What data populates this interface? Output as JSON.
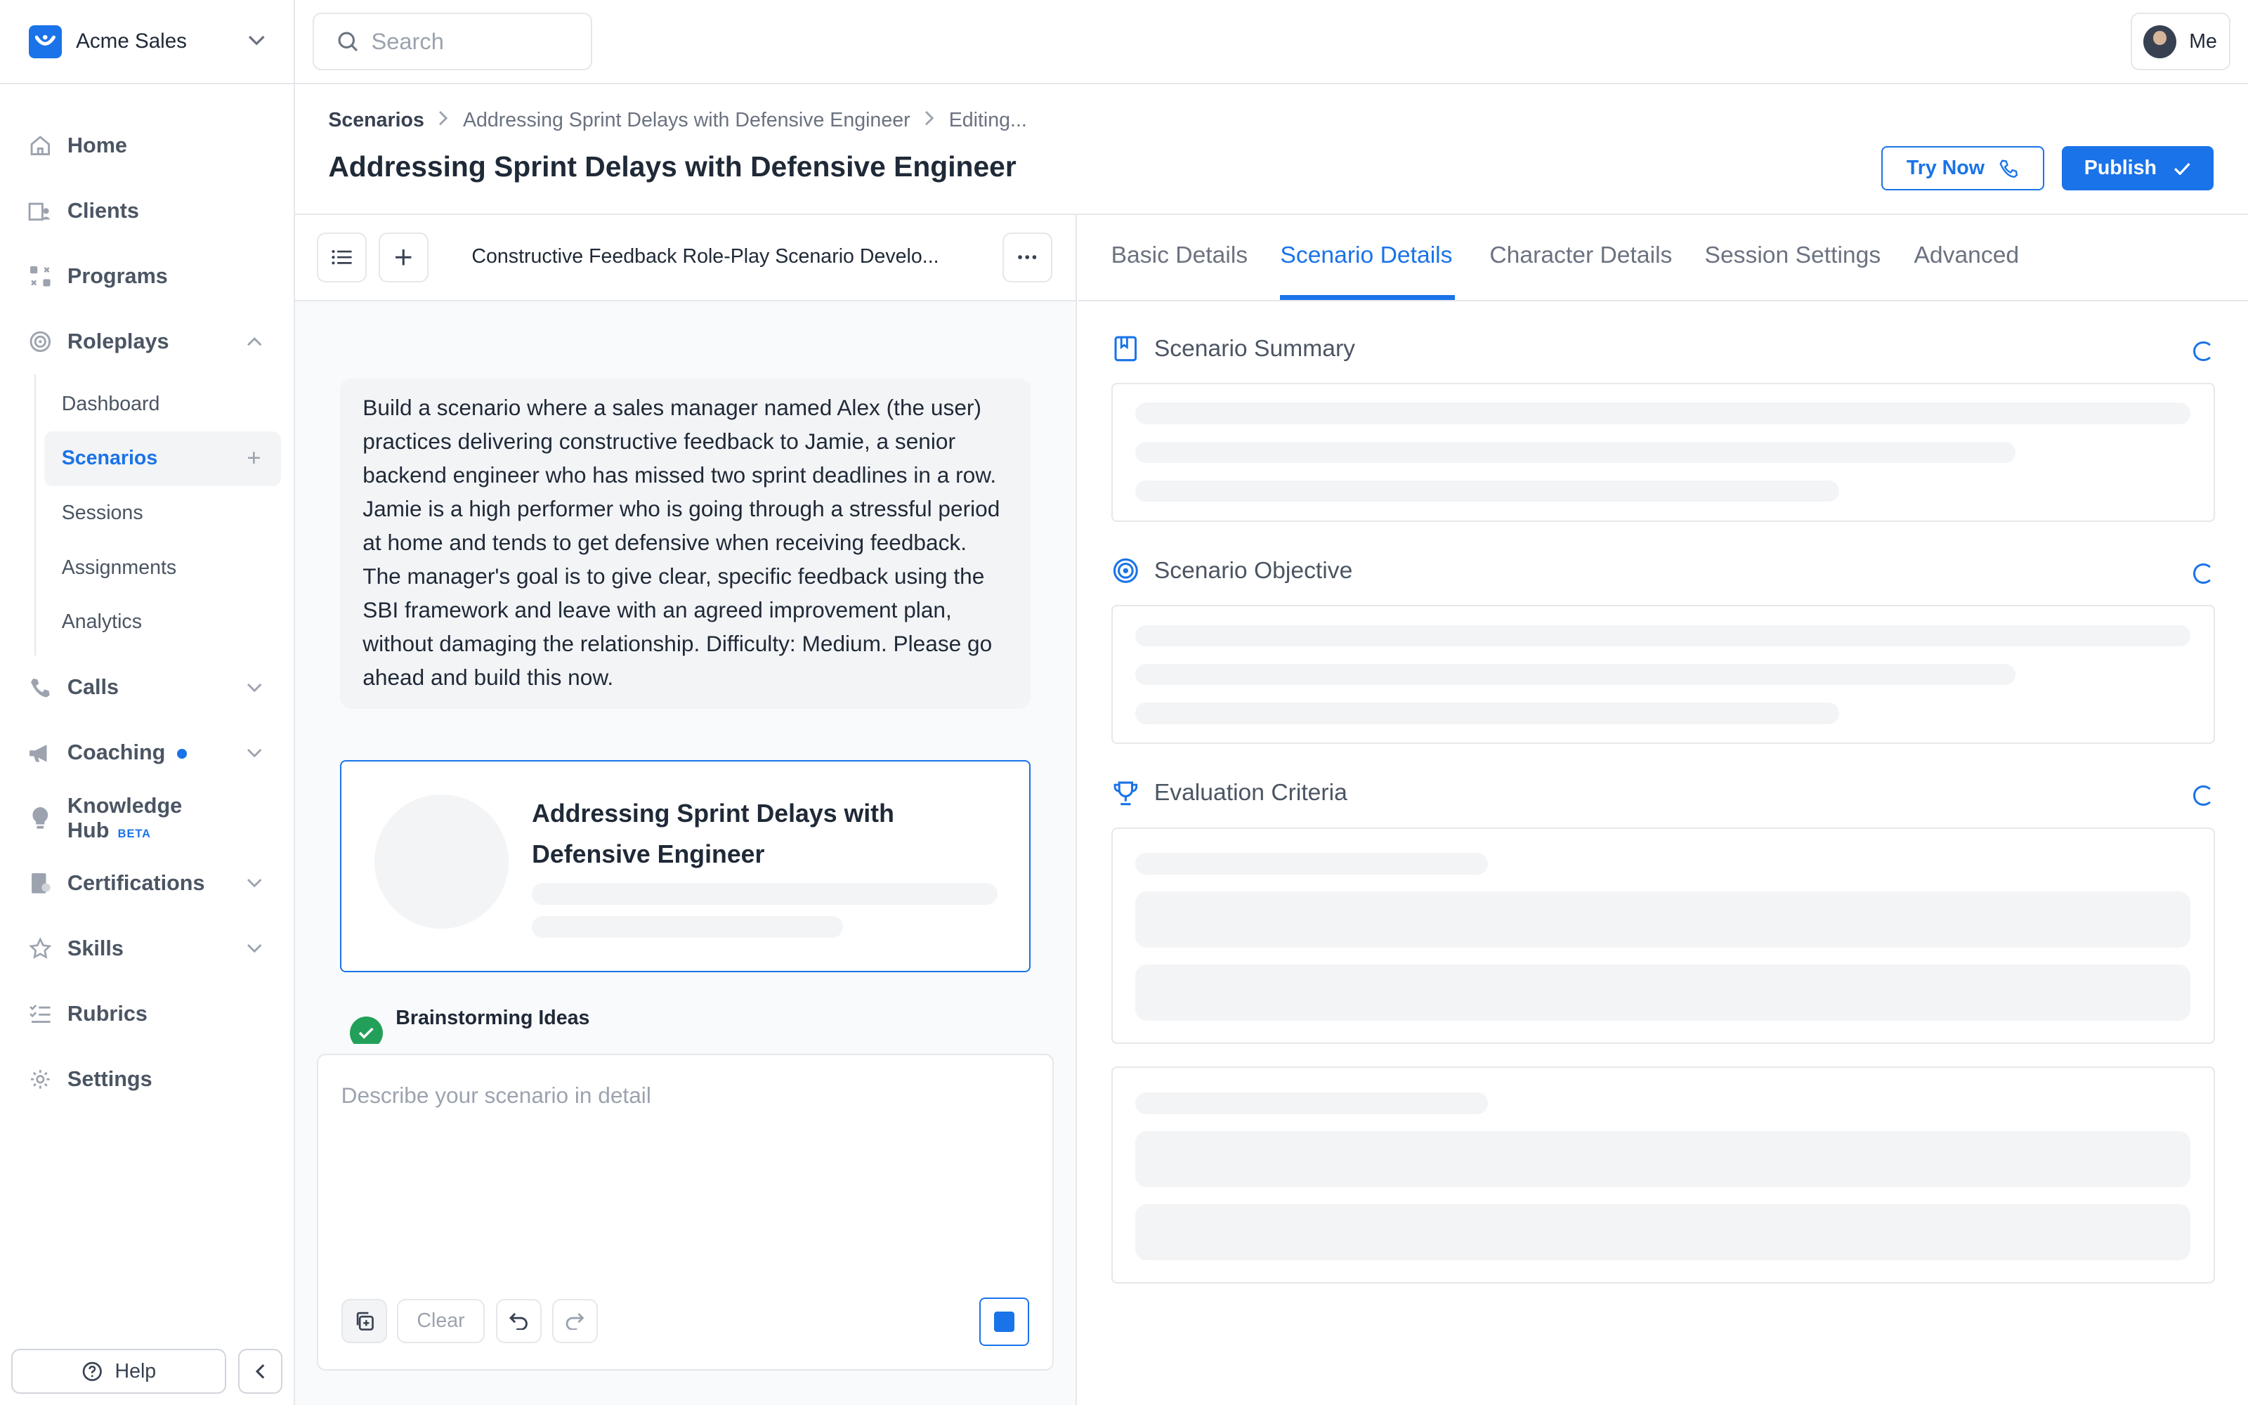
{
  "org": {
    "name": "Acme Sales"
  },
  "search": {
    "placeholder": "Search"
  },
  "user": {
    "label": "Me"
  },
  "nav": {
    "home": "Home",
    "clients": "Clients",
    "programs": "Programs",
    "roleplays": "Roleplays",
    "roleplays_sub": [
      "Dashboard",
      "Scenarios",
      "Sessions",
      "Assignments",
      "Analytics"
    ],
    "calls": "Calls",
    "coaching": "Coaching",
    "knowledge_hub": "Knowledge Hub",
    "knowledge_hub_badge": "BETA",
    "certifications": "Certifications",
    "skills": "Skills",
    "rubrics": "Rubrics",
    "settings": "Settings",
    "help": "Help"
  },
  "breadcrumb": [
    "Scenarios",
    "Addressing Sprint Delays with Defensive Engineer",
    "Editing..."
  ],
  "page": {
    "title": "Addressing Sprint Delays with Defensive Engineer",
    "try_now": "Try Now",
    "publish": "Publish"
  },
  "chat": {
    "conversation_title": "Constructive Feedback Role-Play Scenario Develo...",
    "user_message": "Build a scenario where a sales manager named Alex (the user) practices delivering constructive feedback to Jamie, a senior backend engineer who has missed two sprint deadlines in a row. Jamie is a high performer who is going through a stressful period at home and tends to get defensive when receiving feedback. The manager's goal is to give clear, specific feedback using the SBI framework and leave with an agreed improvement plan, without damaging the relationship. Difficulty: Medium. Please go ahead and build this now.",
    "card_title": "Addressing Sprint Delays with Defensive Engineer",
    "step_title": "Brainstorming Ideas",
    "input_placeholder": "Describe your scenario in detail",
    "clear_label": "Clear"
  },
  "tabs": [
    "Basic Details",
    "Scenario Details",
    "Character Details",
    "Session Settings",
    "Advanced"
  ],
  "active_tab": "Scenario Details",
  "sections": {
    "summary": "Scenario Summary",
    "objective": "Scenario Objective",
    "evaluation": "Evaluation Criteria"
  },
  "colors": {
    "accent": "#1a73e8",
    "success": "#22a05a",
    "skeleton": "#f3f4f6"
  }
}
